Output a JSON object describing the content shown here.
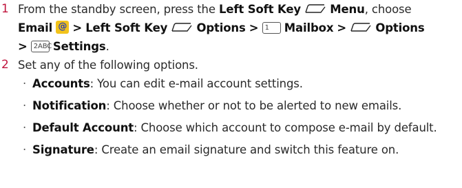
{
  "steps": [
    {
      "number": "1",
      "parts": {
        "t1": "From the standby screen, press the",
        "k1": "Left Soft Key",
        "k2": "Menu",
        "t2": ", choose",
        "k3": "Email",
        "sep1": ">",
        "k4": "Left Soft Key",
        "k5": "Options",
        "sep2": ">",
        "k6": "Mailbox",
        "sep3": ">",
        "k7": "Options",
        "sep4": ">",
        "k8": "Settings",
        "end": ".",
        "key1_label": "1",
        "key2_label": "2ABC",
        "email_glyph": "@"
      }
    },
    {
      "number": "2",
      "text": "Set any of the following options."
    }
  ],
  "options": [
    {
      "term": "Accounts",
      "desc": ": You can edit e-mail account settings."
    },
    {
      "term": "Notification",
      "desc": ": Choose whether or not to be alerted to new emails."
    },
    {
      "term": "Default Account",
      "desc": ": Choose which account to compose e-mail by default."
    },
    {
      "term": "Signature",
      "desc": ": Create an email signature and switch this feature on."
    }
  ],
  "bullet_char": "·",
  "colors": {
    "step_number": "#c0143c",
    "email_icon": "#f2c31b"
  },
  "icons": [
    "left-soft-key-icon",
    "email-app-icon",
    "keypad-1-icon",
    "keypad-2abc-icon"
  ]
}
